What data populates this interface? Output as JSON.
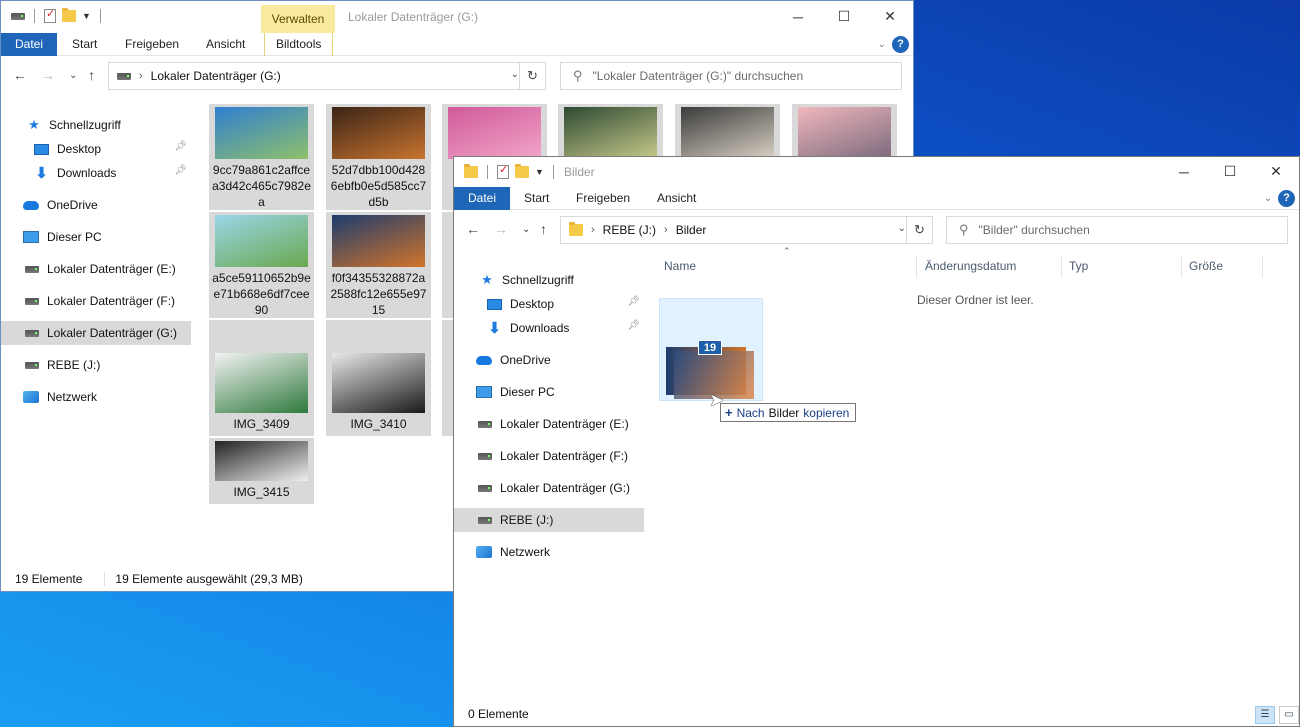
{
  "window1": {
    "title": "Lokaler Datenträger (G:)",
    "verwalten": "Verwalten",
    "tabs": [
      "Datei",
      "Start",
      "Freigeben",
      "Ansicht",
      "Bildtools"
    ],
    "address": "Lokaler Datenträger (G:)",
    "search_placeholder": "\"Lokaler Datenträger (G:)\" durchsuchen",
    "nav": [
      "Schnellzugriff",
      "Desktop",
      "Downloads",
      "OneDrive",
      "Dieser PC",
      "Lokaler Datenträger (E:)",
      "Lokaler Datenträger (F:)",
      "Lokaler Datenträger (G:)",
      "REBE (J:)",
      "Netzwerk"
    ],
    "files": [
      {
        "name": "9cc79a861c2affcea3d42c465c7982ea",
        "c1": "#2f7fd1",
        "c2": "#8fc06a"
      },
      {
        "name": "52d7dbb100d4286ebfb0e5d585cc7d5b",
        "c1": "#3a2416",
        "c2": "#c9742f"
      },
      {
        "name": "",
        "c1": "#d05a9a",
        "c2": "#f2a5c8"
      },
      {
        "name": "",
        "c1": "#2e4a32",
        "c2": "#c7c98a"
      },
      {
        "name": "",
        "c1": "#3b3b3b",
        "c2": "#d9d1c4"
      },
      {
        "name": "",
        "c1": "#f0b7bd",
        "c2": "#7b6a7c"
      },
      {
        "name": "a5ce59110652b9ee71b668e6df7cee90",
        "c1": "#9ad6e8",
        "c2": "#6aa84f"
      },
      {
        "name": "f0f34355328872a2588fc12e655e9715",
        "c1": "#1d3c6e",
        "c2": "#d2742a"
      },
      {
        "name": "IMG_3409",
        "c1": "#f2f2f2",
        "c2": "#2f7a3d"
      },
      {
        "name": "IMG_3410",
        "c1": "#e8e8e8",
        "c2": "#1a1a1a"
      },
      {
        "name": "IMG_3415",
        "c1": "#222222",
        "c2": "#f0f0f0"
      }
    ],
    "status_count": "19 Elemente",
    "status_selected": "19 Elemente ausgewählt (29,3 MB)"
  },
  "window2": {
    "title": "Bilder",
    "tabs": [
      "Datei",
      "Start",
      "Freigeben",
      "Ansicht"
    ],
    "address_drive": "REBE (J:)",
    "address_folder": "Bilder",
    "search_placeholder": "\"Bilder\" durchsuchen",
    "nav": [
      "Schnellzugriff",
      "Desktop",
      "Downloads",
      "OneDrive",
      "Dieser PC",
      "Lokaler Datenträger (E:)",
      "Lokaler Datenträger (F:)",
      "Lokaler Datenträger (G:)",
      "REBE (J:)",
      "Netzwerk"
    ],
    "columns": [
      "Name",
      "Änderungsdatum",
      "Typ",
      "Größe"
    ],
    "empty_text": "Dieser Ordner ist leer.",
    "drag_count": "19",
    "drag_tip_pre": "Nach",
    "drag_tip_target": "Bilder",
    "drag_tip_post": "kopieren",
    "status_count": "0 Elemente"
  }
}
